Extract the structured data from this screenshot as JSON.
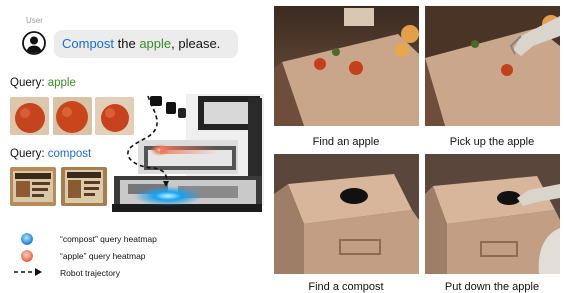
{
  "user": {
    "label": "User",
    "utterance_parts": [
      {
        "text": "Compost",
        "color": "#1c6bd6"
      },
      {
        "text": " the ",
        "color": "#111111"
      },
      {
        "text": "apple",
        "color": "#3a8d26"
      },
      {
        "text": ", please.",
        "color": "#111111"
      }
    ]
  },
  "queries": [
    {
      "prefix": "Query: ",
      "term": "apple",
      "color": "#3a8d26"
    },
    {
      "prefix": "Query: ",
      "term": "compost",
      "color": "#1c6bd6"
    }
  ],
  "legend": {
    "compost_heatmap": "“compost” query heatmap",
    "apple_heatmap": "“apple” query heatmap",
    "trajectory": "Robot trajectory"
  },
  "captions": {
    "find_apple": "Find an apple",
    "pick_up": "Pick up the apple",
    "find_compost": "Find a compost",
    "put_down": "Put down the apple"
  },
  "colors": {
    "compost_heatmap": "#1aa0f0",
    "apple_heatmap": "#f07a5a"
  }
}
